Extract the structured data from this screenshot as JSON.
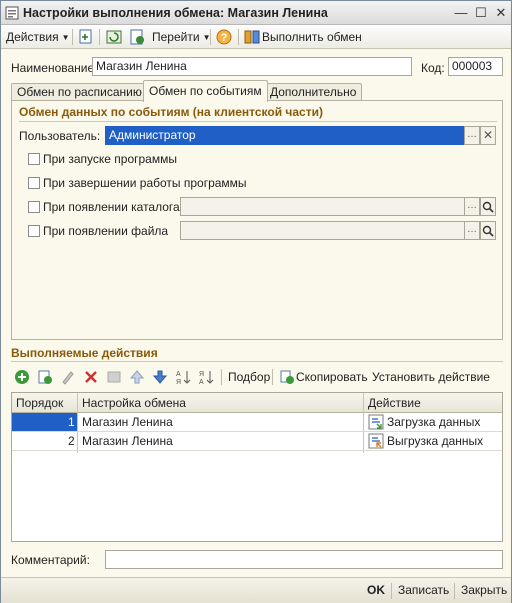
{
  "window": {
    "title": "Настройки выполнения обмена: Магазин Ленина"
  },
  "toolbar": {
    "actions_label": "Действия",
    "goto_label": "Перейти",
    "execute_label": "Выполнить обмен"
  },
  "form": {
    "name_label": "Наименование:",
    "name_value": "Магазин Ленина",
    "code_label": "Код:",
    "code_value": "000003"
  },
  "tabs": [
    {
      "label": "Обмен по расписанию"
    },
    {
      "label": "Обмен по событиям"
    },
    {
      "label": "Дополнительно"
    }
  ],
  "events_panel": {
    "group_title": "Обмен данных по событиям (на клиентской части)",
    "user_label": "Пользователь:",
    "user_value": "Администратор",
    "on_start_label": "При запуске программы",
    "on_exit_label": "При завершении работы программы",
    "on_catalog_label": "При появлении каталога",
    "on_file_label": "При появлении файла"
  },
  "actions_section": {
    "title": "Выполняемые действия",
    "pick_label": "Подбор",
    "copy_label": "Скопировать",
    "set_action_label": "Установить действие"
  },
  "grid": {
    "columns": [
      "Порядок",
      "Настройка обмена",
      "Действие"
    ],
    "rows": [
      {
        "order": "1",
        "setting": "Магазин Ленина",
        "action": "Загрузка данных"
      },
      {
        "order": "2",
        "setting": "Магазин Ленина",
        "action": "Выгрузка данных"
      }
    ]
  },
  "comment": {
    "label": "Комментарий:",
    "value": ""
  },
  "footer": {
    "ok_label": "OK",
    "save_label": "Записать",
    "close_label": "Закрыть"
  },
  "colors": {
    "selection": "#1f5fc6",
    "section_title": "#8a5a0b",
    "window_bg": "#fbf8ec"
  }
}
